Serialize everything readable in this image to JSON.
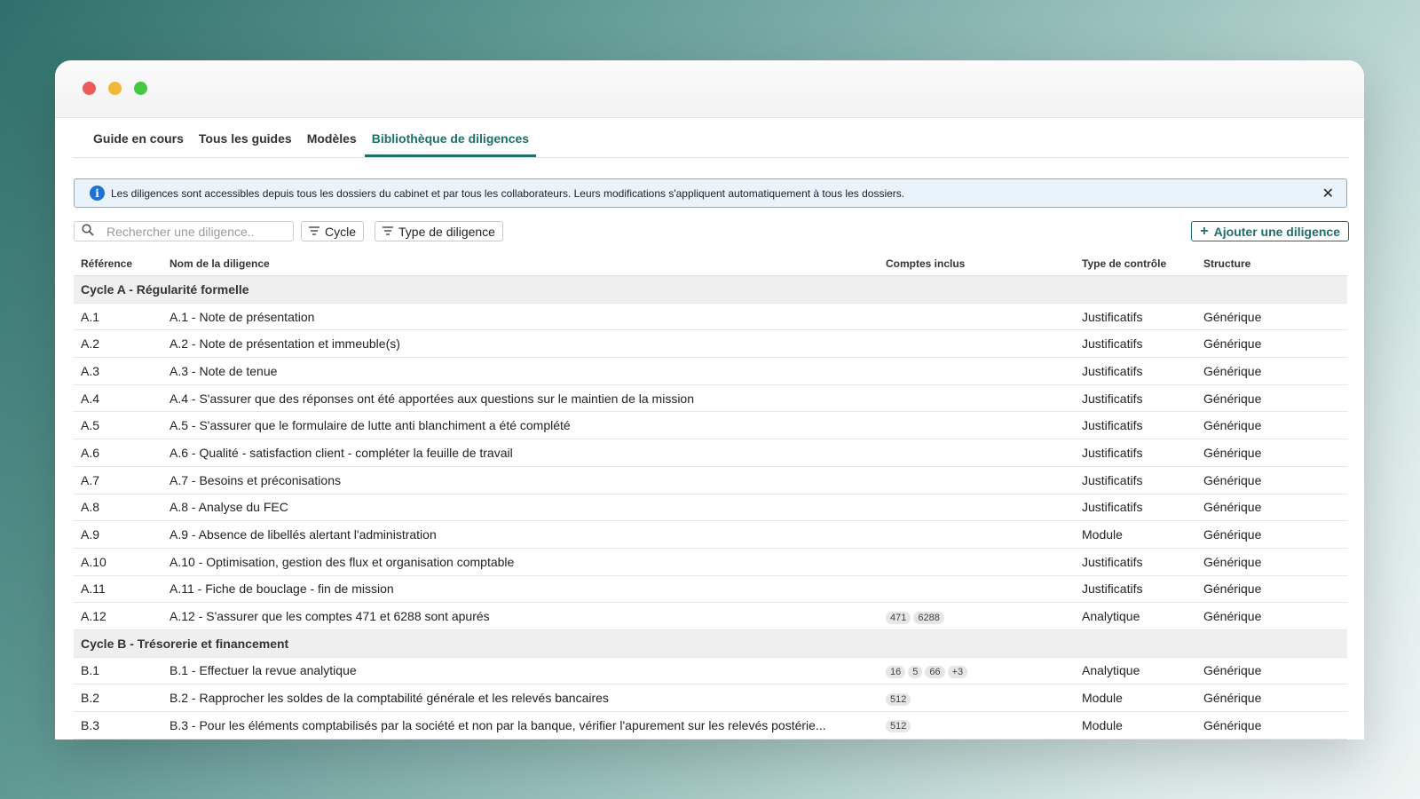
{
  "tabs": [
    "Guide en cours",
    "Tous les guides",
    "Modèles",
    "Bibliothèque de diligences"
  ],
  "active_tab": "Bibliothèque de diligences",
  "banner": {
    "message": "Les diligences sont accessibles depuis tous les dossiers du cabinet et par tous les collaborateurs. Leurs modifications s'appliquent automatiquement à tous les dossiers.",
    "close_label": "✕"
  },
  "toolbar": {
    "search_placeholder": "Rechercher une diligence..",
    "filter_cycle": "Cycle",
    "filter_type": "Type de diligence",
    "add_label": "Ajouter une diligence"
  },
  "table": {
    "headers": [
      "Référence",
      "Nom de la diligence",
      "Comptes inclus",
      "Type de contrôle",
      "Structure"
    ],
    "groups": [
      {
        "title": "Cycle A - Régularité formelle",
        "rows": [
          {
            "ref": "A.1",
            "name": "A.1 - Note de présentation",
            "accounts": [],
            "control": "Justificatifs",
            "structure": "Générique"
          },
          {
            "ref": "A.2",
            "name": "A.2 - Note de présentation et immeuble(s)",
            "accounts": [],
            "control": "Justificatifs",
            "structure": "Générique"
          },
          {
            "ref": "A.3",
            "name": "A.3 - Note de tenue",
            "accounts": [],
            "control": "Justificatifs",
            "structure": "Générique"
          },
          {
            "ref": "A.4",
            "name": "A.4 - S'assurer que des réponses ont été apportées aux questions sur le maintien de la mission",
            "accounts": [],
            "control": "Justificatifs",
            "structure": "Générique"
          },
          {
            "ref": "A.5",
            "name": "A.5 - S'assurer que le formulaire de lutte anti blanchiment a été complété",
            "accounts": [],
            "control": "Justificatifs",
            "structure": "Générique"
          },
          {
            "ref": "A.6",
            "name": "A.6 - Qualité - satisfaction client - compléter la feuille de travail",
            "accounts": [],
            "control": "Justificatifs",
            "structure": "Générique"
          },
          {
            "ref": "A.7",
            "name": "A.7 - Besoins et préconisations",
            "accounts": [],
            "control": "Justificatifs",
            "structure": "Générique"
          },
          {
            "ref": "A.8",
            "name": "A.8 - Analyse du FEC",
            "accounts": [],
            "control": "Justificatifs",
            "structure": "Générique"
          },
          {
            "ref": "A.9",
            "name": "A.9 - Absence de libellés alertant l'administration",
            "accounts": [],
            "control": "Module",
            "structure": "Générique"
          },
          {
            "ref": "A.10",
            "name": "A.10 - Optimisation, gestion des flux et organisation comptable",
            "accounts": [],
            "control": "Justificatifs",
            "structure": "Générique"
          },
          {
            "ref": "A.11",
            "name": "A.11 - Fiche de bouclage - fin de mission",
            "accounts": [],
            "control": "Justificatifs",
            "structure": "Générique"
          },
          {
            "ref": "A.12",
            "name": "A.12 - S'assurer que les comptes 471 et 6288 sont apurés",
            "accounts": [
              "471",
              "6288"
            ],
            "control": "Analytique",
            "structure": "Générique"
          }
        ]
      },
      {
        "title": "Cycle B - Trésorerie et financement",
        "rows": [
          {
            "ref": "B.1",
            "name": "B.1 - Effectuer la revue analytique",
            "accounts": [
              "16",
              "5",
              "66",
              "+3"
            ],
            "control": "Analytique",
            "structure": "Générique"
          },
          {
            "ref": "B.2",
            "name": "B.2 - Rapprocher les soldes de la comptabilité générale et les relevés bancaires",
            "accounts": [
              "512"
            ],
            "control": "Module",
            "structure": "Générique"
          },
          {
            "ref": "B.3",
            "name": "B.3 - Pour les éléments comptabilisés par la société et non par la banque, vérifier l'apurement sur les relevés postérie...",
            "accounts": [
              "512"
            ],
            "control": "Module",
            "structure": "Générique"
          }
        ]
      }
    ]
  },
  "colors": {
    "accent": "#1e6e6a",
    "info": "#1d72d6",
    "banner_bg": "#e8f3fc"
  }
}
